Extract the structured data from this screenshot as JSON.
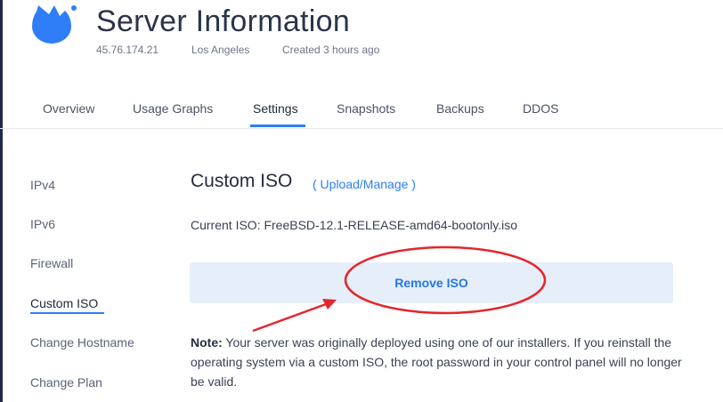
{
  "header": {
    "title": "Server Information",
    "ip": "45.76.174.21",
    "location": "Los Angeles",
    "created": "Created 3 hours ago",
    "logo_icon": "droplet-logo-icon",
    "brand_color": "#2f7ef7"
  },
  "tabs": [
    {
      "label": "Overview"
    },
    {
      "label": "Usage Graphs"
    },
    {
      "label": "Settings"
    },
    {
      "label": "Snapshots"
    },
    {
      "label": "Backups"
    },
    {
      "label": "DDOS"
    }
  ],
  "active_tab": "Settings",
  "sidebar": {
    "items": [
      {
        "label": "IPv4"
      },
      {
        "label": "IPv6"
      },
      {
        "label": "Firewall"
      },
      {
        "label": "Custom ISO"
      },
      {
        "label": "Change Hostname"
      },
      {
        "label": "Change Plan"
      }
    ],
    "active": "Custom ISO"
  },
  "main": {
    "section_title": "Custom ISO",
    "section_link": "( Upload/Manage )",
    "current_iso": "Current ISO: FreeBSD-12.1-RELEASE-amd64-bootonly.iso",
    "remove_button": "Remove ISO",
    "note_label": "Note:",
    "note_text": " Your server was originally deployed using one of our installers. If you reinstall the operating system via a custom ISO, the root password in your control panel will no longer be valid."
  },
  "annotation": {
    "color": "#e3262b",
    "shapes": [
      "ellipse-around-remove-button",
      "arrow-pointing-to-remove-button"
    ]
  }
}
